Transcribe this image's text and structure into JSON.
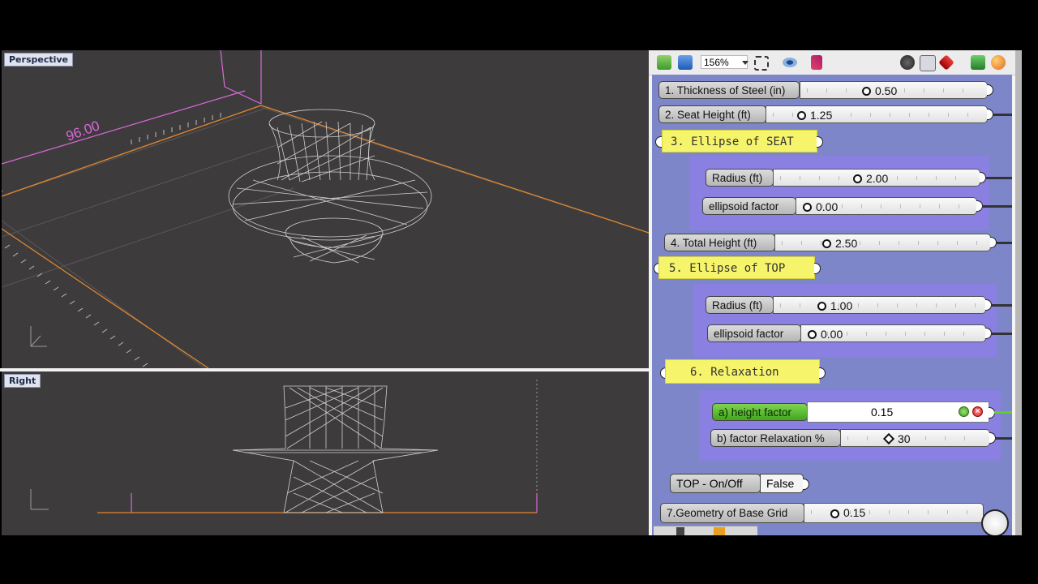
{
  "viewports": {
    "top": {
      "label": "Perspective",
      "dimension": "96.00"
    },
    "bottom": {
      "label": "Right"
    }
  },
  "toolbar": {
    "zoom": "156%",
    "icons": [
      "open-folder-icon",
      "save-icon",
      "zoom-dropdown",
      "zoom-extents-icon",
      "preview-eye-icon",
      "sketch-icon",
      "display-mode-icon",
      "wire-display-icon",
      "bake-icon",
      "paint-icon",
      "sphere-icon"
    ]
  },
  "sliders": {
    "thickness": {
      "label": "1. Thickness of Steel (in)",
      "value": "0.50"
    },
    "seat_height": {
      "label": "2. Seat Height (ft)",
      "value": "1.25"
    },
    "seat_radius": {
      "label": "Radius (ft)",
      "value": "2.00"
    },
    "seat_ellipsoid": {
      "label": "ellipsoid factor",
      "value": "0.00"
    },
    "total_height": {
      "label": "4. Total Height (ft)",
      "value": "2.50"
    },
    "top_radius": {
      "label": "Radius (ft)",
      "value": "1.00"
    },
    "top_ellipsoid": {
      "label": "ellipsoid factor",
      "value": "0.00"
    },
    "height_factor": {
      "label": "a) height factor",
      "value": "0.15"
    },
    "factor_relax": {
      "label": "b) factor Relaxation %",
      "value": "30"
    },
    "base_grid": {
      "label": "7.Geometry of Base Grid",
      "value": "0.15"
    }
  },
  "panels": {
    "seat": "3. Ellipse of SEAT",
    "top": "5. Ellipse of TOP",
    "relax": "6. Relaxation"
  },
  "toggle": {
    "label": "TOP - On/Off",
    "value": "False"
  },
  "colors": {
    "canvas": "#7c86c9",
    "group": "#8a7fe3",
    "panel": "#f6f46a",
    "active_slider": "#55b82a",
    "viewport_bg": "#3e3b3d"
  }
}
